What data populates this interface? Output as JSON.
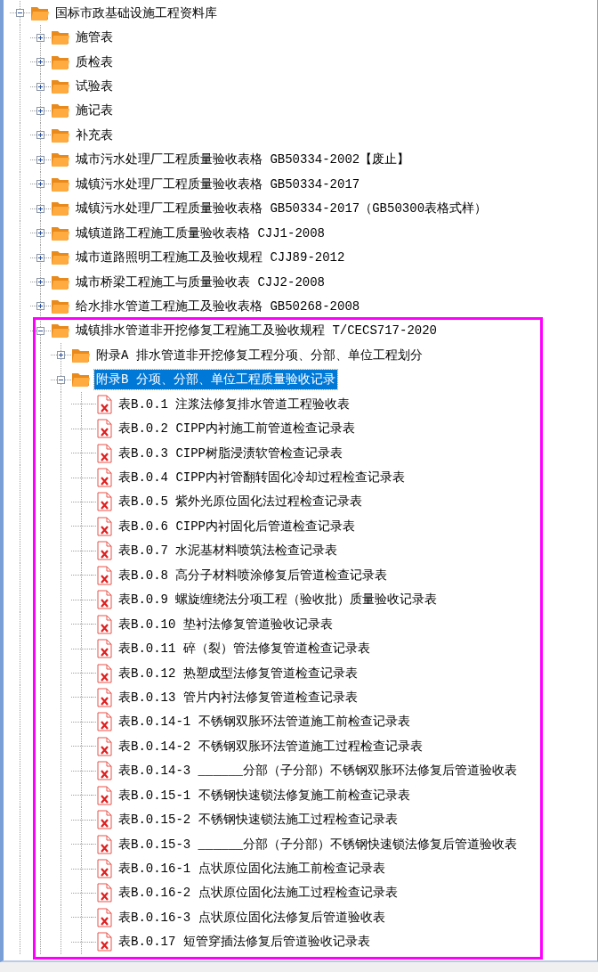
{
  "tree": [
    {
      "label": "国标市政基础设施工程资料库",
      "kind": "folder",
      "expanded": true,
      "selected": false,
      "children": [
        {
          "label": "施管表",
          "kind": "folder",
          "expanded": false,
          "selected": false
        },
        {
          "label": "质检表",
          "kind": "folder",
          "expanded": false,
          "selected": false
        },
        {
          "label": "试验表",
          "kind": "folder",
          "expanded": false,
          "selected": false
        },
        {
          "label": "施记表",
          "kind": "folder",
          "expanded": false,
          "selected": false
        },
        {
          "label": "补充表",
          "kind": "folder",
          "expanded": false,
          "selected": false
        },
        {
          "label": "城市污水处理厂工程质量验收表格 GB50334-2002【废止】",
          "kind": "folder",
          "expanded": false,
          "selected": false
        },
        {
          "label": "城镇污水处理厂工程质量验收表格 GB50334-2017",
          "kind": "folder",
          "expanded": false,
          "selected": false
        },
        {
          "label": "城镇污水处理厂工程质量验收表格 GB50334-2017（GB50300表格式样）",
          "kind": "folder",
          "expanded": false,
          "selected": false
        },
        {
          "label": "城镇道路工程施工质量验收表格 CJJ1-2008",
          "kind": "folder",
          "expanded": false,
          "selected": false
        },
        {
          "label": "城市道路照明工程施工及验收规程 CJJ89-2012",
          "kind": "folder",
          "expanded": false,
          "selected": false
        },
        {
          "label": "城市桥梁工程施工与质量验收表 CJJ2-2008",
          "kind": "folder",
          "expanded": false,
          "selected": false
        },
        {
          "label": "给水排水管道工程施工及验收表格 GB50268-2008",
          "kind": "folder",
          "expanded": false,
          "selected": false
        },
        {
          "label": "城镇排水管道非开挖修复工程施工及验收规程 T/CECS717-2020",
          "kind": "folder",
          "expanded": true,
          "selected": false,
          "children": [
            {
              "label": "附录A 排水管道非开挖修复工程分项、分部、单位工程划分",
              "kind": "folder",
              "expanded": false,
              "selected": false
            },
            {
              "label": "附录B 分项、分部、单位工程质量验收记录",
              "kind": "folder",
              "expanded": true,
              "selected": true,
              "children": [
                {
                  "label": "表B.0.1 注浆法修复排水管道工程验收表",
                  "kind": "file",
                  "selected": false
                },
                {
                  "label": "表B.0.2 CIPP内衬施工前管道检查记录表",
                  "kind": "file",
                  "selected": false
                },
                {
                  "label": "表B.0.3 CIPP树脂浸渍软管检查记录表",
                  "kind": "file",
                  "selected": false
                },
                {
                  "label": "表B.0.4 CIPP内衬管翻转固化冷却过程检查记录表",
                  "kind": "file",
                  "selected": false
                },
                {
                  "label": "表B.0.5 紫外光原位固化法过程检查记录表",
                  "kind": "file",
                  "selected": false
                },
                {
                  "label": "表B.0.6 CIPP内衬固化后管道检查记录表",
                  "kind": "file",
                  "selected": false
                },
                {
                  "label": "表B.0.7 水泥基材料喷筑法检查记录表",
                  "kind": "file",
                  "selected": false
                },
                {
                  "label": "表B.0.8 高分子材料喷涂修复后管道检查记录表",
                  "kind": "file",
                  "selected": false
                },
                {
                  "label": "表B.0.9 螺旋缠绕法分项工程（验收批）质量验收记录表",
                  "kind": "file",
                  "selected": false
                },
                {
                  "label": "表B.0.10 垫衬法修复管道验收记录表",
                  "kind": "file",
                  "selected": false
                },
                {
                  "label": "表B.0.11 碎（裂）管法修复管道检查记录表",
                  "kind": "file",
                  "selected": false
                },
                {
                  "label": "表B.0.12 热塑成型法修复管道检查记录表",
                  "kind": "file",
                  "selected": false
                },
                {
                  "label": "表B.0.13 管片内衬法修复管道检查记录表",
                  "kind": "file",
                  "selected": false
                },
                {
                  "label": "表B.0.14-1 不锈钢双胀环法管道施工前检查记录表",
                  "kind": "file",
                  "selected": false
                },
                {
                  "label": "表B.0.14-2 不锈钢双胀环法管道施工过程检查记录表",
                  "kind": "file",
                  "selected": false
                },
                {
                  "label": "表B.0.14-3 ______分部（子分部）不锈钢双胀环法修复后管道验收表",
                  "kind": "file",
                  "selected": false
                },
                {
                  "label": "表B.0.15-1 不锈钢快速锁法修复施工前检查记录表",
                  "kind": "file",
                  "selected": false
                },
                {
                  "label": "表B.0.15-2 不锈钢快速锁法施工过程检查记录表",
                  "kind": "file",
                  "selected": false
                },
                {
                  "label": "表B.0.15-3 ______分部（子分部）不锈钢快速锁法修复后管道验收表",
                  "kind": "file",
                  "selected": false
                },
                {
                  "label": "表B.0.16-1 点状原位固化法施工前检查记录表",
                  "kind": "file",
                  "selected": false
                },
                {
                  "label": "表B.0.16-2 点状原位固化法施工过程检查记录表",
                  "kind": "file",
                  "selected": false
                },
                {
                  "label": "表B.0.16-3 点状原位固化法修复后管道验收表",
                  "kind": "file",
                  "selected": false
                },
                {
                  "label": "表B.0.17 短管穿插法修复后管道验收记录表",
                  "kind": "file",
                  "selected": false
                }
              ]
            }
          ]
        }
      ]
    }
  ]
}
